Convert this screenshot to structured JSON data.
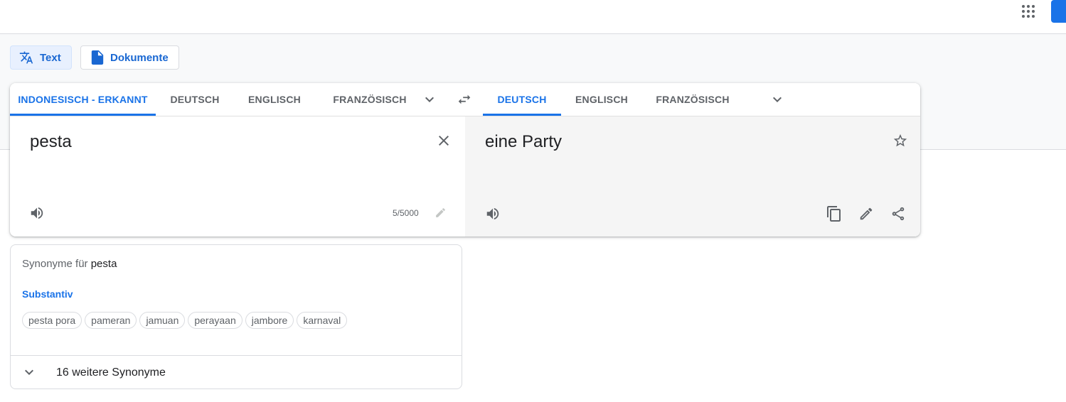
{
  "header": {
    "apps_icon": "apps-grid-icon",
    "account_color": "#1a73e8"
  },
  "modes": {
    "text_label": "Text",
    "text_icon": "translate-icon",
    "documents_label": "Dokumente",
    "documents_icon": "document-icon"
  },
  "source_languages": {
    "tabs": [
      {
        "label": "INDONESISCH - ERKANNT",
        "active": true
      },
      {
        "label": "DEUTSCH",
        "active": false
      },
      {
        "label": "ENGLISCH",
        "active": false
      },
      {
        "label": "FRANZÖSISCH",
        "active": false
      }
    ],
    "more_icon": "chevron-down-icon"
  },
  "swap_icon": "swap-arrows-icon",
  "target_languages": {
    "tabs": [
      {
        "label": "DEUTSCH",
        "active": true
      },
      {
        "label": "ENGLISCH",
        "active": false
      },
      {
        "label": "FRANZÖSISCH",
        "active": false
      }
    ],
    "more_icon": "chevron-down-icon"
  },
  "source": {
    "text": "pesta",
    "char_count": "5/5000",
    "clear_icon": "close-icon",
    "listen_icon": "speaker-icon",
    "edit_icon": "pencil-icon"
  },
  "target": {
    "text": "eine Party",
    "star_icon": "star-outline-icon",
    "listen_icon": "speaker-icon",
    "copy_icon": "copy-icon",
    "edit_icon": "pencil-icon",
    "share_icon": "share-icon"
  },
  "synonyms": {
    "title_prefix": "Synonyme für",
    "word": "pesta",
    "part_of_speech": "Substantiv",
    "items": [
      "pesta pora",
      "pameran",
      "jamuan",
      "perayaan",
      "jambore",
      "karnaval"
    ],
    "more_label": "16 weitere Synonyme",
    "expand_icon": "chevron-down-icon"
  },
  "colors": {
    "accent": "#1a73e8",
    "target_background": "#f5f5f5",
    "band_background": "#f8f9fa"
  }
}
